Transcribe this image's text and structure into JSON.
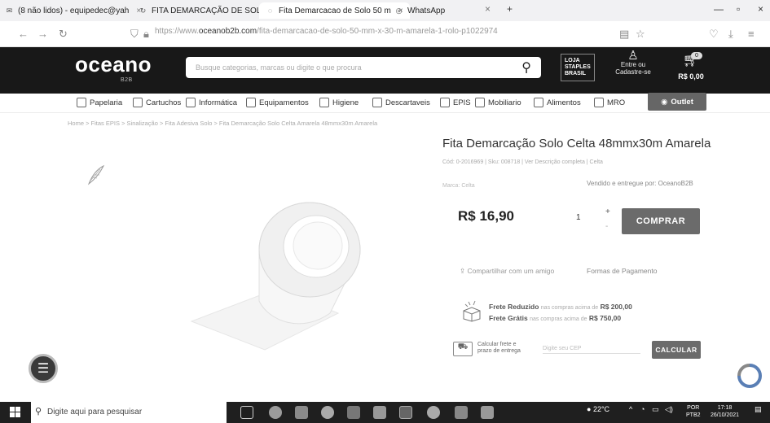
{
  "browser": {
    "tabs": [
      {
        "label": "(8 não lidos) - equipedec@yah",
        "icon": "mail-icon"
      },
      {
        "label": "FITA DEMARCAÇÃO DE SOLO",
        "icon": "loading-icon"
      },
      {
        "label": "Fita Demarcacao de Solo 50 m",
        "icon": "page-icon"
      },
      {
        "label": "WhatsApp",
        "icon": "whatsapp-icon"
      }
    ],
    "new_tab": "+",
    "url_prefix": "https://www.",
    "url_domain": "oceanob2b.com",
    "url_path": "/fita-demarcacao-de-solo-50-mm-x-30-m-amarela-1-rolo-p1022974"
  },
  "header": {
    "logo": "oceano",
    "logo_sub": "B2B",
    "search_placeholder": "Busque categorias, marcas ou digite o que procura",
    "staples_line1": "LOJA",
    "staples_line2": "STAPLES",
    "staples_line3": "BRASIL",
    "login_line1": "Entre ou",
    "login_line2": "Cadastre-se",
    "cart_count": "0",
    "cart_total": "R$ 0,00"
  },
  "categories": [
    {
      "label": "Papelaria"
    },
    {
      "label": "Cartuchos"
    },
    {
      "label": "Informática"
    },
    {
      "label": "Equipamentos"
    },
    {
      "label": "Higiene"
    },
    {
      "label": "Descartaveis"
    },
    {
      "label": "EPIS"
    },
    {
      "label": "Mobiliario"
    },
    {
      "label": "Alimentos"
    },
    {
      "label": "MRO"
    }
  ],
  "outlet": "Outlet",
  "breadcrumb": "Home  >  Fitas EPIS  >  Sinalização  >  Fita Adesiva Solo  >  Fita Demarcação Solo Celta Amarela 48mmx30m Amarela",
  "product": {
    "title": "Fita Demarcação Solo Celta 48mmx30m Amarela",
    "sku": "Cód: 0-2016969 | Sku: 008718 | Ver Descrição completa | Celta",
    "brand": "Marca: Celta",
    "sold_by": "Vendido e entregue por: OceanoB2B",
    "price": "R$ 16,90",
    "quantity": "1",
    "buy_label": "COMPRAR",
    "share": "Compartilhar com um amigo",
    "payment": "Formas de Pagamento",
    "frete_reduzido": "Frete Reduzido",
    "frete_reduzido_text": "nas compras acima de",
    "frete_reduzido_value": "R$ 200,00",
    "frete_gratis": "Frete Grátis",
    "frete_gratis_text": "nas compras acima de",
    "frete_gratis_value": "R$ 750,00",
    "calc_line1": "Calcular frete e",
    "calc_line2": "prazo de entrega",
    "cep_placeholder": "Digite seu CEP",
    "calc_button": "CALCULAR"
  },
  "taskbar": {
    "search_placeholder": "Digite aqui para pesquisar",
    "weather": "22°C",
    "lang1": "POR",
    "lang2": "PTB2",
    "time": "17:18",
    "date": "26/10/2021"
  },
  "colors": {
    "header_bg": "#181818",
    "button_bg": "#6b6b6b"
  }
}
